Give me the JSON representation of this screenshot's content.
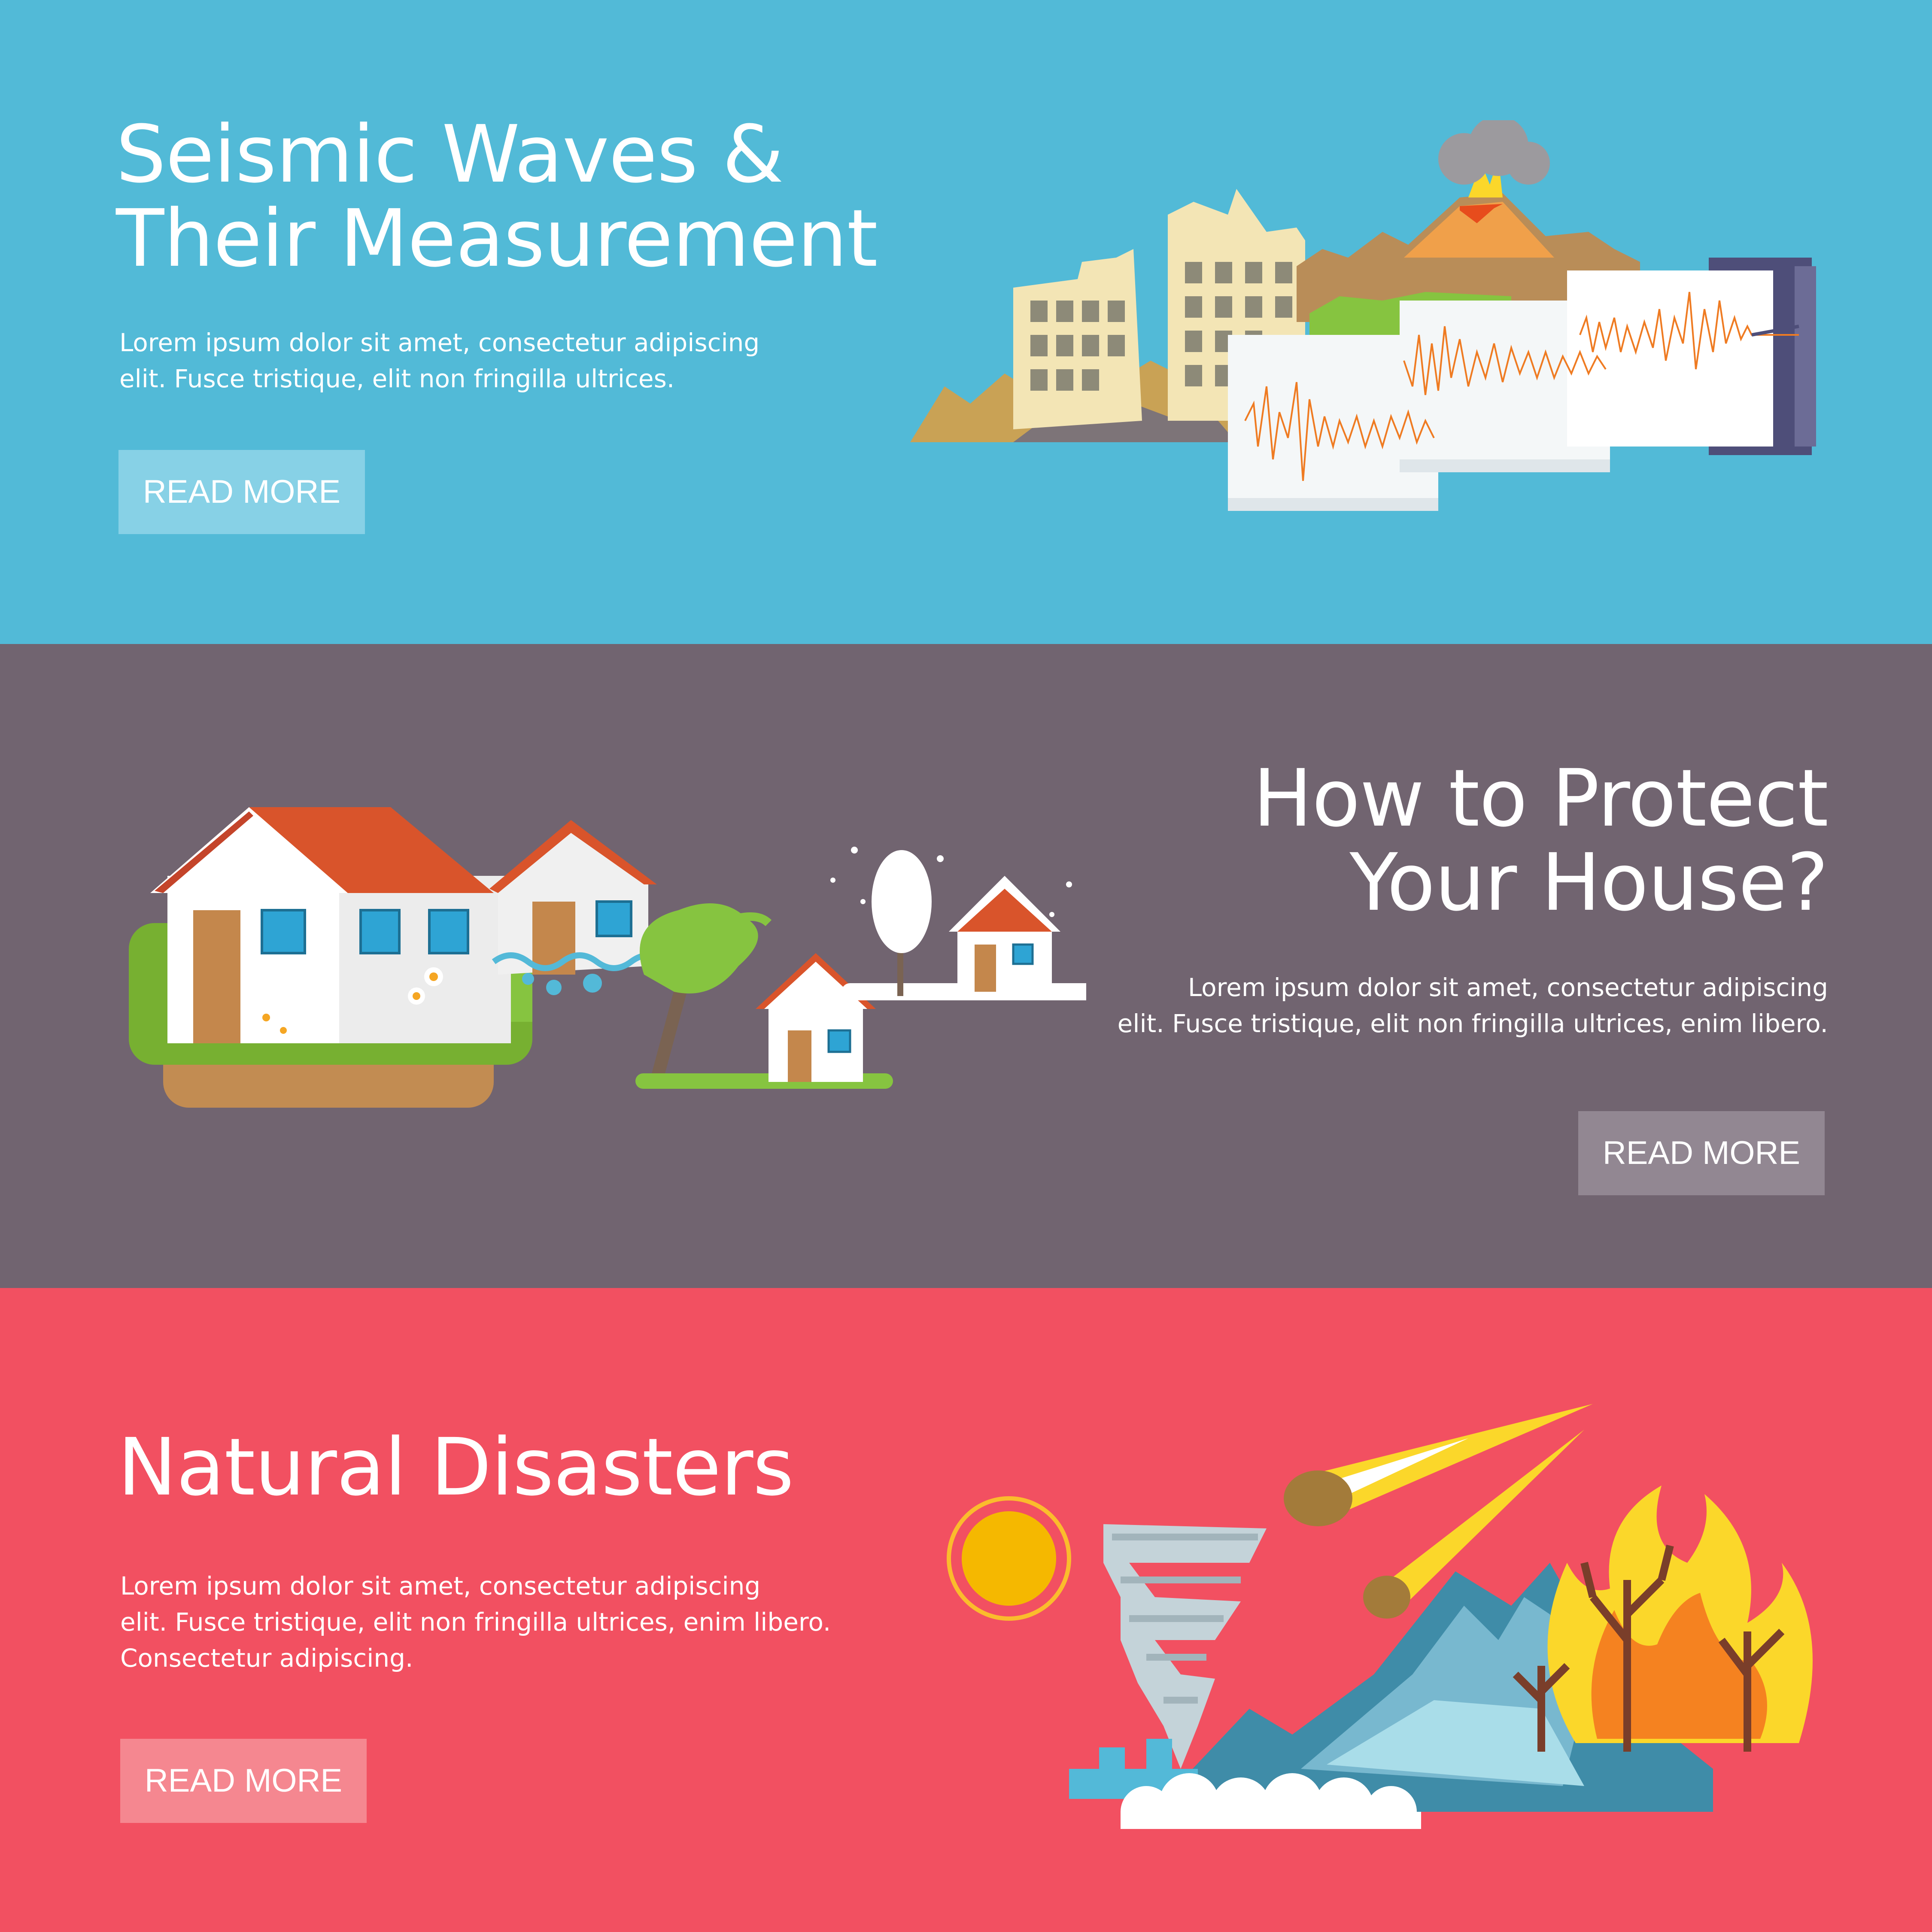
{
  "banners": [
    {
      "title_lines": [
        "Seismic Waves &",
        "Their Measurement"
      ],
      "body_lines": [
        "Lorem ipsum dolor sit amet, consectetur adipiscing",
        "elit. Fusce tristique, elit non fringilla ultrices."
      ],
      "button_label": "READ MORE",
      "background": "#52bad7",
      "button_color": "#87d1e6"
    },
    {
      "title_lines": [
        "How to Protect",
        "Your House?"
      ],
      "body_lines": [
        "Lorem ipsum dolor sit amet, consectetur adipiscing",
        "elit. Fusce tristique, elit non fringilla ultrices, enim libero."
      ],
      "button_label": "READ MORE",
      "background": "#716470",
      "button_color": "#928792"
    },
    {
      "title_lines": [
        "Natural Disasters"
      ],
      "body_lines": [
        "Lorem ipsum dolor sit amet, consectetur adipiscing",
        "elit. Fusce tristique, elit non fringilla ultrices, enim libero.",
        "Consectetur adipiscing."
      ],
      "button_label": "READ MORE",
      "background": "#f25061",
      "button_color": "#f58790"
    }
  ]
}
